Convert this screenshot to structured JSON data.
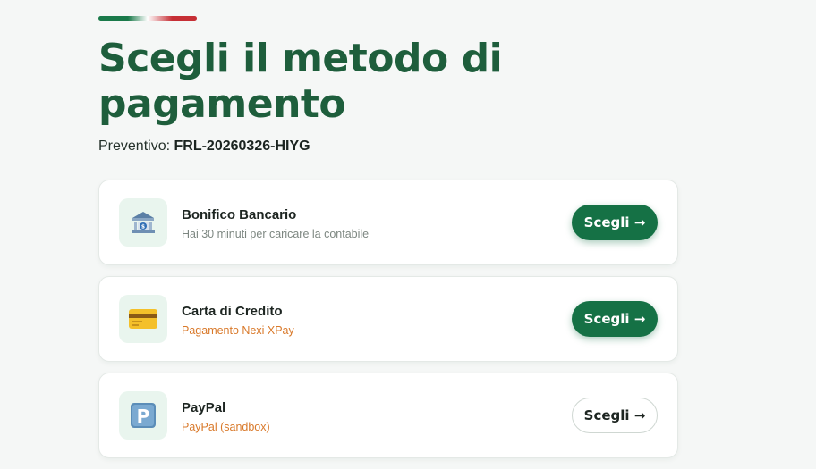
{
  "page": {
    "title": "Scegli il metodo di pagamento",
    "quote_label": "Preventivo:",
    "quote_code": "FRL-20260326-HIYG"
  },
  "methods": [
    {
      "name": "Bonifico Bancario",
      "description": "Hai 30 minuti per caricare la contabile",
      "icon": "bank-icon",
      "button_label": "Scegli →",
      "button_style": "filled"
    },
    {
      "name": "Carta di Credito",
      "description": "Pagamento Nexi XPay",
      "icon": "credit-card-icon",
      "button_label": "Scegli →",
      "button_style": "filled"
    },
    {
      "name": "PayPal",
      "description": "PayPal (sandbox)",
      "icon": "paypal-p-icon",
      "button_label": "Scegli →",
      "button_style": "outline"
    }
  ],
  "colors": {
    "title_green": "#1e5e3c",
    "button_green": "#157145",
    "accent_orange": "#d9792a",
    "icon_tile_bg": "#e9f5ee",
    "flag_green": "#1a7a4a",
    "flag_red": "#c62f35"
  }
}
